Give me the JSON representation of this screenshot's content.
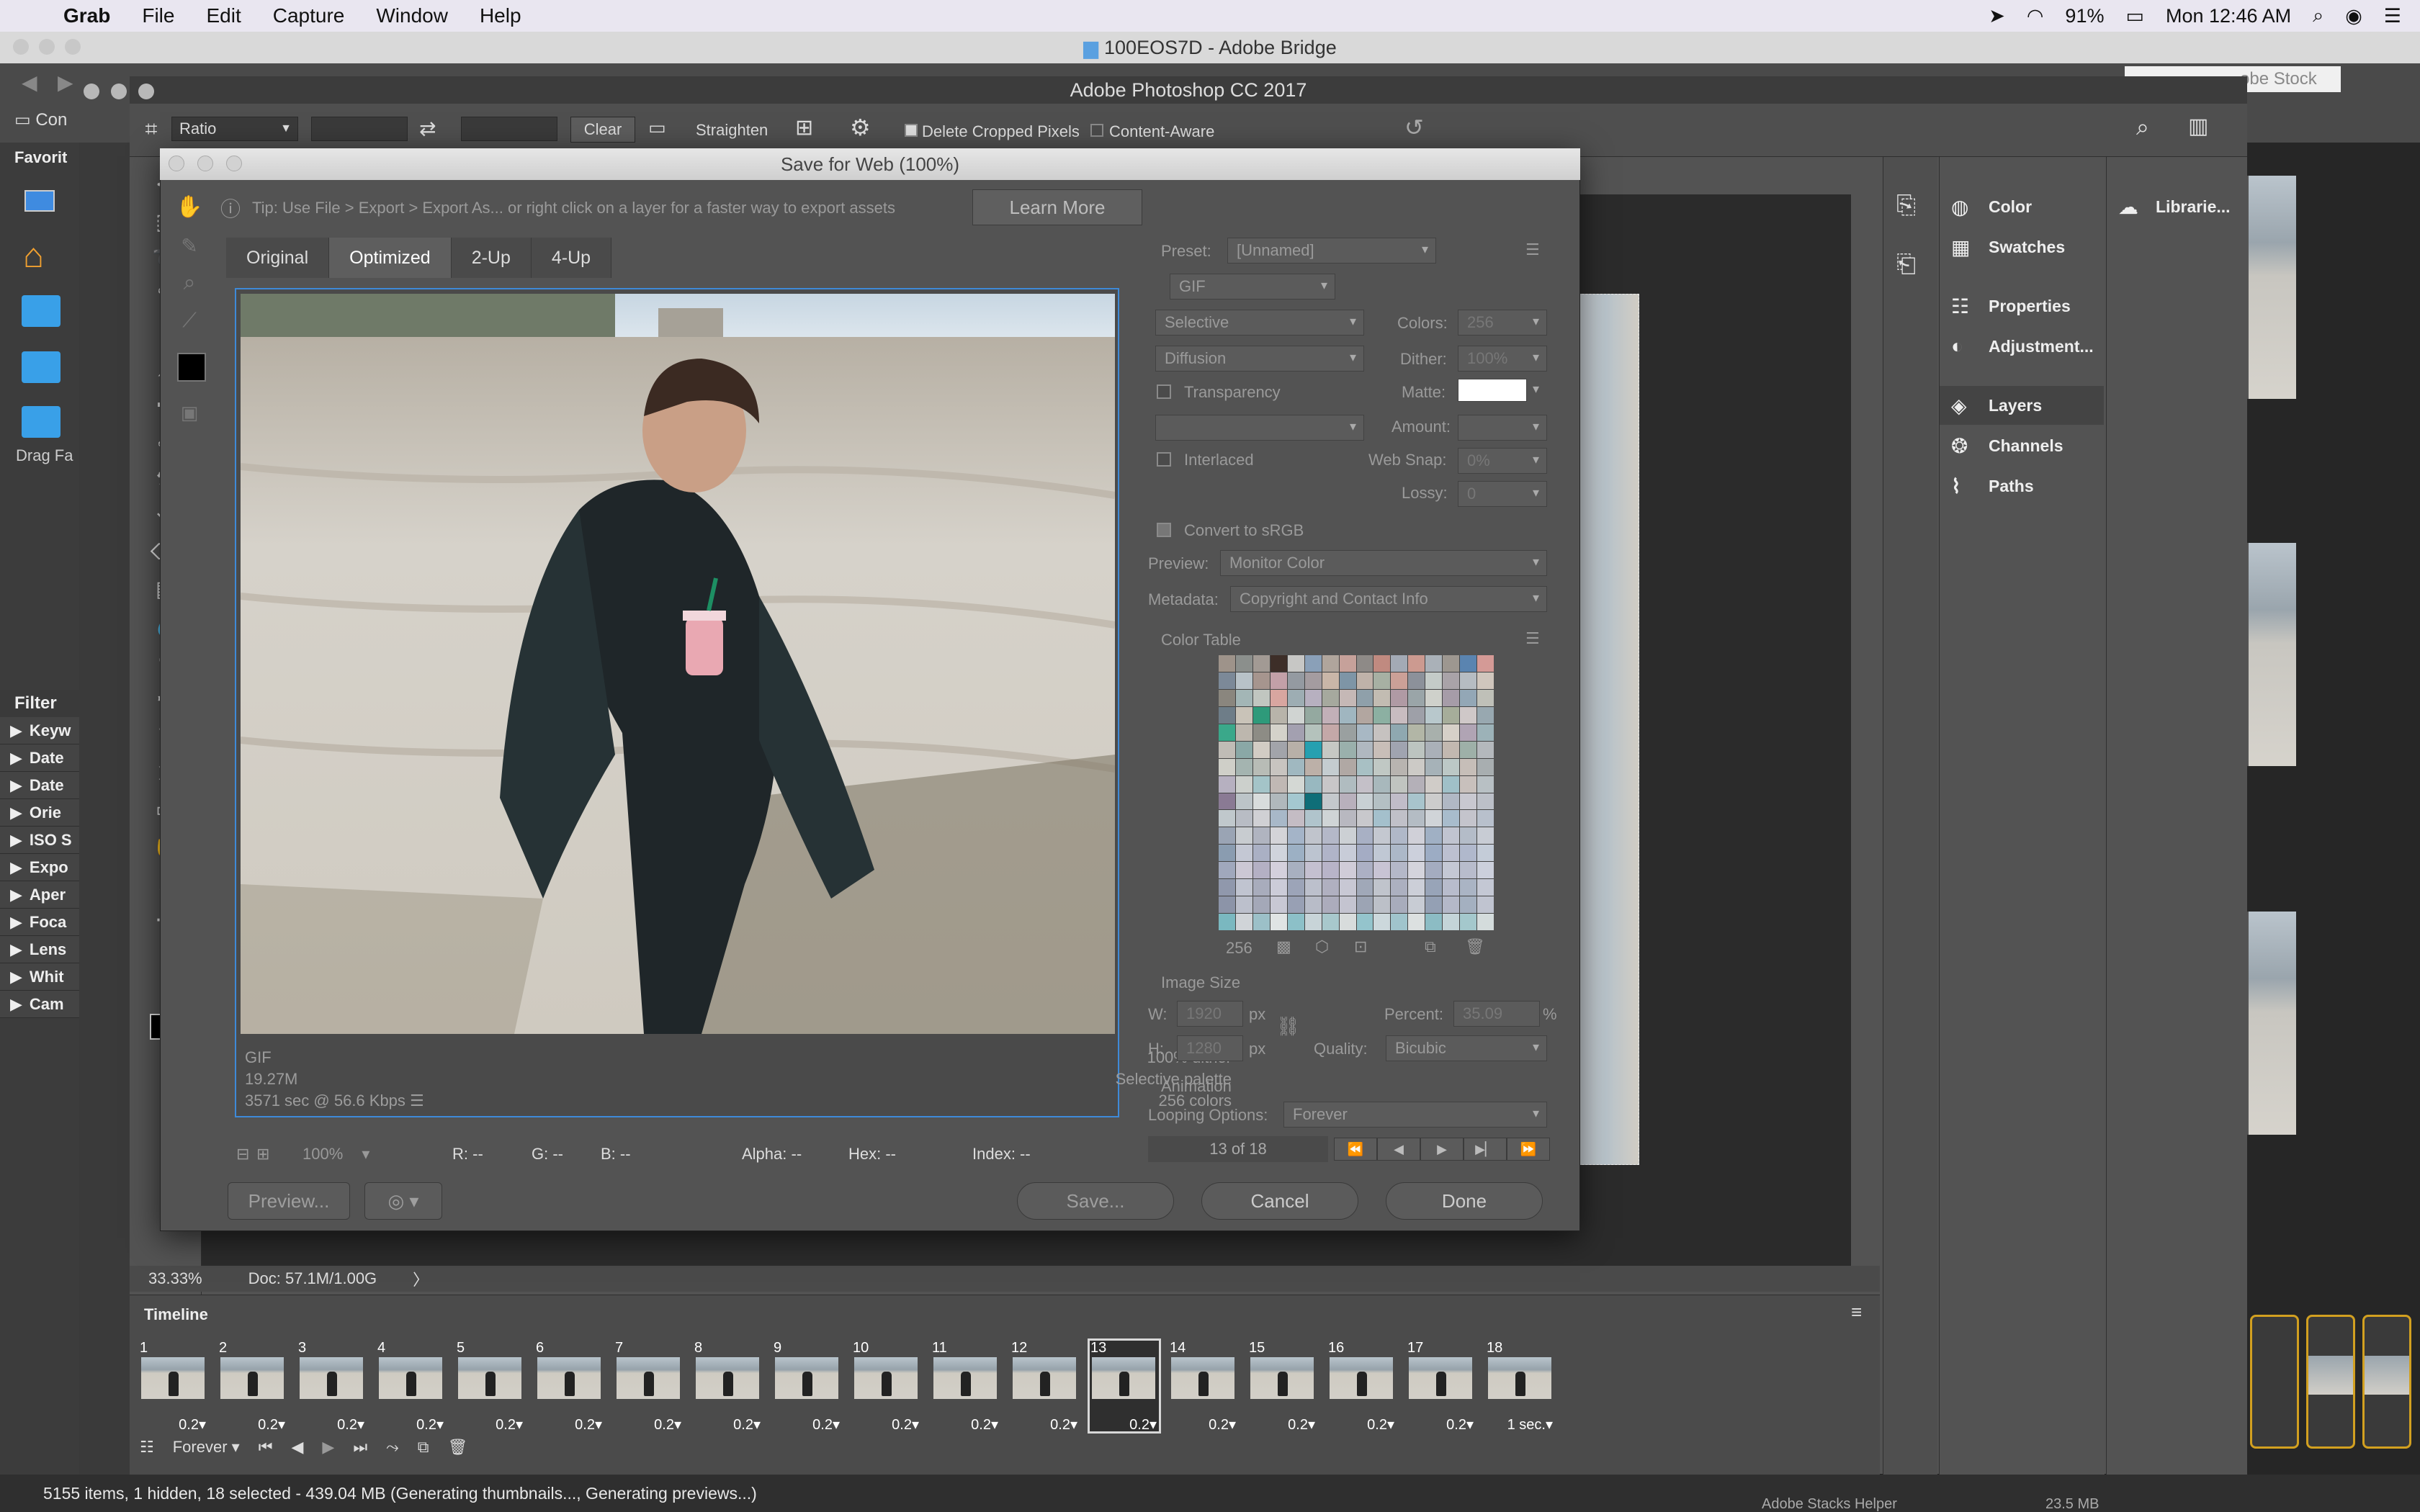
{
  "menubar": {
    "apple": "",
    "app": "Grab",
    "items": [
      "File",
      "Edit",
      "Capture",
      "Window",
      "Help"
    ],
    "battery": "91%",
    "clock": "Mon 12:46 AM"
  },
  "bridge": {
    "title": "100EOS7D - Adobe Bridge",
    "stock_search": "obe Stock",
    "favorites_label": "Favorit",
    "drag_label": "Drag Fa",
    "filter_label": "Filter",
    "filters": [
      "Keyw",
      "Date",
      "Date",
      "Orie",
      "ISO S",
      "Expo",
      "Aper",
      "Foca",
      "Lens",
      "Whit",
      "Cam"
    ],
    "status": "5155 items, 1 hidden, 18 selected - 439.04 MB (Generating thumbnails..., Generating previews...)",
    "bottom_right_text": "Adobe Stacks Helper",
    "bottom_right_size": "23.5 MB",
    "con_label": "Con"
  },
  "photoshop": {
    "title": "Adobe Photoshop CC 2017",
    "options": {
      "ratio": "Ratio",
      "clear": "Clear",
      "straighten": "Straighten",
      "delete_cropped": "Delete Cropped Pixels",
      "content_aware": "Content-Aware"
    },
    "zoom": "33.33%",
    "doc": "Doc: 57.1M/1.00G",
    "timeline": {
      "label": "Timeline",
      "loop": "Forever",
      "frames": [
        {
          "n": "1",
          "d": "0.2"
        },
        {
          "n": "2",
          "d": "0.2"
        },
        {
          "n": "3",
          "d": "0.2"
        },
        {
          "n": "4",
          "d": "0.2"
        },
        {
          "n": "5",
          "d": "0.2"
        },
        {
          "n": "6",
          "d": "0.2"
        },
        {
          "n": "7",
          "d": "0.2"
        },
        {
          "n": "8",
          "d": "0.2"
        },
        {
          "n": "9",
          "d": "0.2"
        },
        {
          "n": "10",
          "d": "0.2"
        },
        {
          "n": "11",
          "d": "0.2"
        },
        {
          "n": "12",
          "d": "0.2"
        },
        {
          "n": "13",
          "d": "0.2"
        },
        {
          "n": "14",
          "d": "0.2"
        },
        {
          "n": "15",
          "d": "0.2"
        },
        {
          "n": "16",
          "d": "0.2"
        },
        {
          "n": "17",
          "d": "0.2"
        },
        {
          "n": "18",
          "d": "1 sec."
        }
      ],
      "selected_frame": "13"
    },
    "panels": {
      "group1": [
        "Color",
        "Swatches"
      ],
      "group2": [
        "Properties",
        "Adjustment..."
      ],
      "group3": [
        "Layers",
        "Channels",
        "Paths"
      ],
      "libraries": "Librarie..."
    }
  },
  "dialog": {
    "title": "Save for Web (100%)",
    "tip": "Tip: Use File > Export > Export As...  or right click on a layer for a faster way to export assets",
    "learn_more": "Learn More",
    "tabs": [
      "Original",
      "Optimized",
      "2-Up",
      "4-Up"
    ],
    "active_tab": "Optimized",
    "info_left": [
      "GIF",
      "19.27M",
      "3571 sec @ 56.6 Kbps"
    ],
    "info_right": [
      "100% dither",
      "Selective palette",
      "256 colors"
    ],
    "zoom": "100%",
    "readout": {
      "r": "R: --",
      "g": "G: --",
      "b": "B: --",
      "alpha": "Alpha: --",
      "hex": "Hex: --",
      "index": "Index: --"
    },
    "preview_btn": "Preview...",
    "save_btn": "Save...",
    "cancel_btn": "Cancel",
    "done_btn": "Done",
    "settings": {
      "preset_label": "Preset:",
      "preset": "[Unnamed]",
      "format": "GIF",
      "reduction": "Selective",
      "colors_label": "Colors:",
      "colors": "256",
      "dither_algo": "Diffusion",
      "dither_label": "Dither:",
      "dither": "100%",
      "transparency": "Transparency",
      "matte_label": "Matte:",
      "amount_label": "Amount:",
      "interlaced": "Interlaced",
      "websnap_label": "Web Snap:",
      "websnap": "0%",
      "lossy_label": "Lossy:",
      "lossy": "0",
      "convert_srgb": "Convert to sRGB",
      "preview_label": "Preview:",
      "preview": "Monitor Color",
      "metadata_label": "Metadata:",
      "metadata": "Copyright and Contact Info",
      "color_table": "Color Table",
      "color_count": "256",
      "image_size": "Image Size",
      "w_label": "W:",
      "w": "1920",
      "h_label": "H:",
      "h": "1280",
      "px": "px",
      "percent_label": "Percent:",
      "percent": "35.09",
      "pct": "%",
      "quality_label": "Quality:",
      "quality": "Bicubic",
      "animation": "Animation",
      "looping_label": "Looping Options:",
      "looping": "Forever",
      "frame_counter": "13 of 18"
    }
  },
  "colors": {
    "accent_blue": "#3e8ad8",
    "dialog_bg": "#535353",
    "ps_bg": "#535353"
  }
}
